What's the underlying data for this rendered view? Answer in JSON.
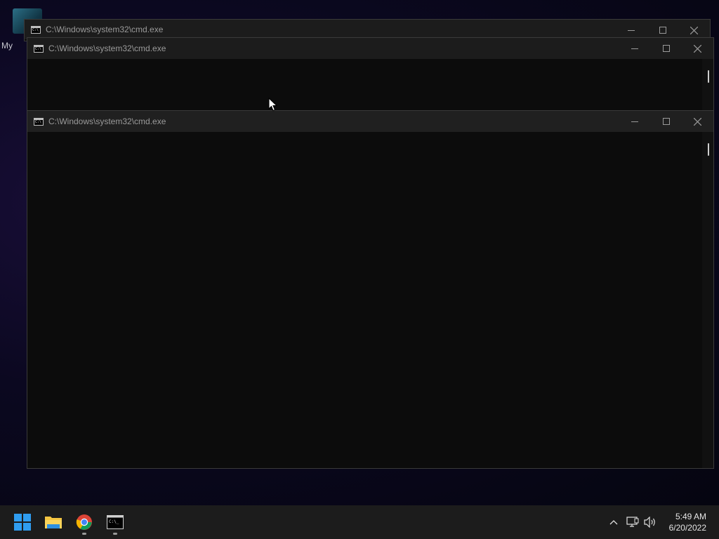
{
  "desktop": {
    "icon_label": "My"
  },
  "windows": [
    {
      "title": "C:\\Windows\\system32\\cmd.exe"
    },
    {
      "title": "C:\\Windows\\system32\\cmd.exe"
    },
    {
      "title": "C:\\Windows\\system32\\cmd.exe"
    }
  ],
  "window_controls": {
    "minimize": "—",
    "maximize": "□",
    "close": "✕"
  },
  "taskbar": {
    "apps": [
      {
        "name": "start-icon"
      },
      {
        "name": "file-explorer-icon"
      },
      {
        "name": "chrome-icon"
      },
      {
        "name": "command-prompt-icon"
      }
    ],
    "tray_icons": [
      "chevron-up-icon",
      "network-icon",
      "volume-icon"
    ],
    "time": "5:49 AM",
    "date": "6/20/2022"
  },
  "colors": {
    "taskbar": "#1c1c1c",
    "titlebar": "#202020",
    "console_bg": "#0c0c0c",
    "accent_blue": "#2f9df0"
  }
}
